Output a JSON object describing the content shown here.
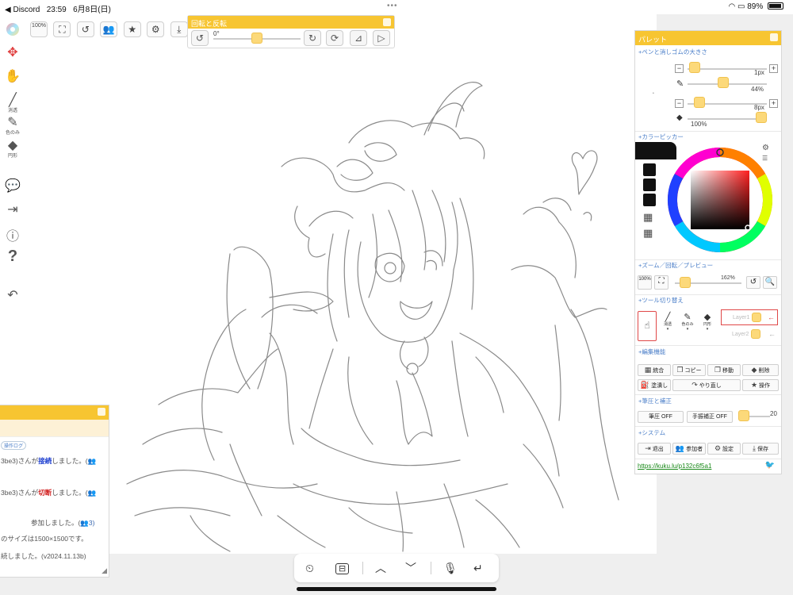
{
  "status_bar": {
    "back_app": "◀ Discord",
    "time": "23:59",
    "date": "6月8日(日)",
    "battery": "89%"
  },
  "top_toolbar": {
    "zoom_label": "100%"
  },
  "rotate_panel": {
    "title": "回転と反転",
    "angle": "0°",
    "angle_value": 0.55
  },
  "left_toolbar": {
    "tools": [
      {
        "icon": "color-wheel-icon"
      },
      {
        "icon": "move-cross-icon"
      },
      {
        "icon": "hand-icon"
      },
      {
        "icon": "pen-icon",
        "label": "消透"
      },
      {
        "icon": "eyedropper-icon",
        "label": "色のみ"
      },
      {
        "icon": "eraser-icon",
        "label": "円形"
      },
      {
        "icon": "chat-icon"
      },
      {
        "icon": "exit-icon"
      },
      {
        "icon": "info-icon"
      },
      {
        "icon": "help-icon"
      },
      {
        "icon": "undo-icon"
      }
    ]
  },
  "chat": {
    "tab_label": "操作ログ",
    "lines": [
      {
        "pre": "3be3)さんが",
        "em": "接続",
        "post": "しました。(",
        "tail": "👥"
      },
      {
        "pre": "3be3)さんが",
        "em": "切断",
        "post": "しました。(",
        "tail": "👥"
      },
      {
        "pre": "参加しました。(",
        "em": "",
        "post": "",
        "tail": "👥3)"
      },
      {
        "pre": "のサイズは1500×1500です。",
        "em": "",
        "post": "",
        "tail": ""
      },
      {
        "pre": "続しました。(v2024.11.13b)",
        "em": "",
        "post": "",
        "tail": ""
      }
    ]
  },
  "palette": {
    "title": "パレット",
    "sections": {
      "pen_eraser_size": "+ペンと消しゴムの大きさ",
      "color_picker": "+カラーピッカー",
      "zoom_rotate_preview": "+ズーム／回転／プレビュー",
      "tool_switch": "+ツール切り替え",
      "edit": "+編集機能",
      "pressure": "+筆圧と補正",
      "system": "+システム"
    },
    "pen_size": "1px",
    "pen_opacity": "44%",
    "eraser_size": "8px",
    "eraser_opacity": "100%",
    "pen_size_level": 0.05,
    "pen_opacity_level": 0.44,
    "eraser_size_level": 0.08,
    "eraser_opacity_level": 1.0,
    "zoom_label": "100%",
    "zoom_value": "162%",
    "zoom_level": 0.1,
    "tool_labels": [
      "消透",
      "色のみ",
      "円形"
    ],
    "layers": [
      "Layer1",
      "Layer2"
    ],
    "edit_buttons": [
      "統合",
      "コピー",
      "移動",
      "削除",
      "塗潰し",
      "やり直し",
      "操作"
    ],
    "pressure_off": "筆圧 OFF",
    "correction_off": "手振補正 OFF",
    "correction_value": "20",
    "system_buttons": [
      "退出",
      "参加者",
      "設定",
      "保存"
    ],
    "url": "https://kuku.lu/p132c6f5a1"
  },
  "colors": {
    "accent": "#f7c531",
    "knob": "#fcd97a",
    "link": "#1a8a1a",
    "section": "#4a7ec8"
  }
}
